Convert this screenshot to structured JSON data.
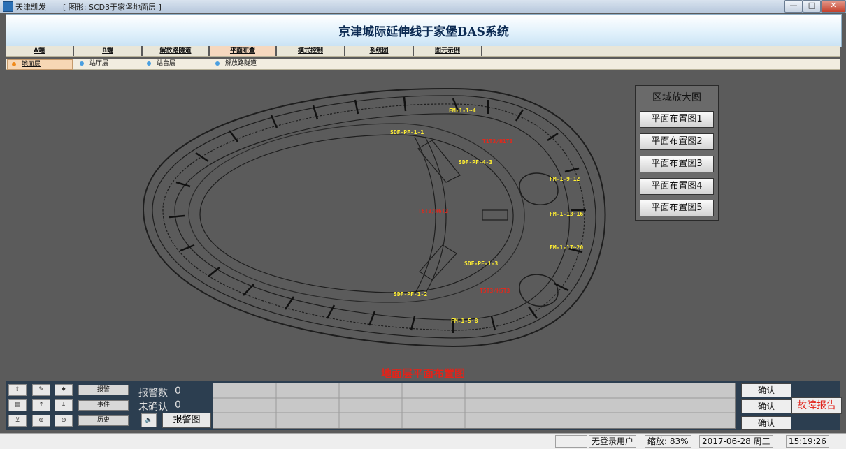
{
  "window": {
    "app_title": "天津凯发",
    "doc_title": "[ 图形: SCD3于家堡地面层 ]",
    "min": "—",
    "max": "□",
    "close": "✕"
  },
  "header": {
    "title": "京津城际延伸线于家堡BAS系统"
  },
  "nav": {
    "tabs": [
      "A端",
      "B端",
      "解放路隧道",
      "平面布置",
      "模式控制",
      "系统图",
      "图元示例"
    ],
    "active": 3
  },
  "subnav": {
    "tabs": [
      "地面层",
      "站厅层",
      "站台层",
      "解放路隧道"
    ],
    "active": 0
  },
  "zoom_panel": {
    "title": "区域放大图",
    "buttons": [
      "平面布置图1",
      "平面布置图2",
      "平面布置图3",
      "平面布置图4",
      "平面布置图5"
    ]
  },
  "map": {
    "labels": {
      "fm1": "FM-1-1~4",
      "sdf1": "SDF-PF-1-1",
      "t1t3": "T1T3/H1T3",
      "sdf4": "SDF-PF-4-3",
      "fm9": "FM-1-9~12",
      "t6t3": "T6T3/H6T3",
      "fm13": "FM-1-13~16",
      "fm17": "FM-1-17~20",
      "sdf3": "SDF-PF-1-3",
      "t5t3": "T5T3/H5T3",
      "sdf2": "SDF-PF-1-2",
      "fm5": "FM-1-5~8"
    },
    "floor_title": "地面层平面布置图"
  },
  "alarm": {
    "buttons": {
      "alarm": "报警",
      "event": "事件",
      "history": "历史"
    },
    "count_label": "报警数",
    "count": "0",
    "unconfirmed_label": "未确认",
    "unconfirmed": "0",
    "alarm_map": "报警图",
    "confirm": "确认",
    "fault_report": "故障报告",
    "icons": [
      "up-arrow-icon",
      "pin-icon",
      "tag-icon",
      "list-icon",
      "arrow-up-icon",
      "arrow-down-icon",
      "filter-icon",
      "plus-icon",
      "minus-icon",
      "mute-icon"
    ]
  },
  "status": {
    "user": "无登录用户",
    "zoom_label": "缩放:",
    "zoom": "83%",
    "date": "2017-06-28",
    "weekday": "周三",
    "time": "15:19:26"
  }
}
